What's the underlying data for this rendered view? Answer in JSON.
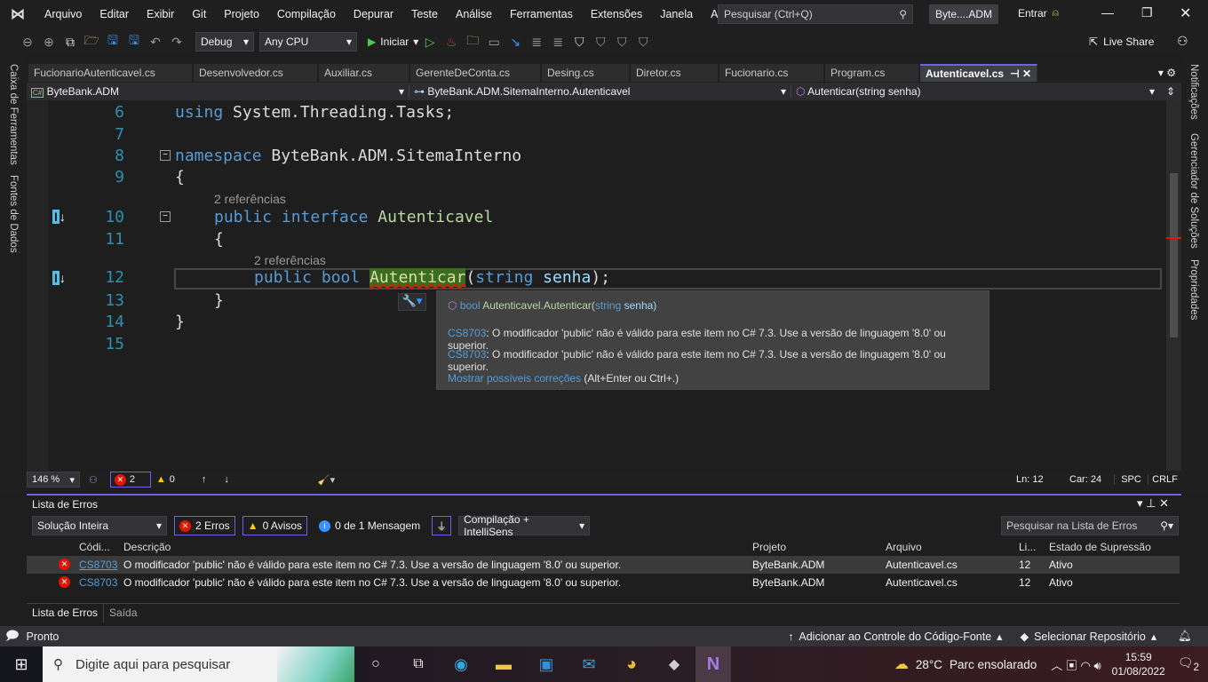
{
  "menu": [
    "Arquivo",
    "Editar",
    "Exibir",
    "Git",
    "Projeto",
    "Compilação",
    "Depurar",
    "Teste",
    "Análise",
    "Ferramentas",
    "Extensões",
    "Janela",
    "Ajuda"
  ],
  "search_placeholder": "Pesquisar (Ctrl+Q)",
  "solution_name": "Byte....ADM",
  "signin": "Entrar",
  "toolbar": {
    "config": "Debug",
    "platform": "Any CPU",
    "start": "Iniciar",
    "live_share": "Live Share"
  },
  "left_strip": [
    "Caixa de Ferramentas",
    "Fontes de Dados"
  ],
  "right_strip": [
    "Notificações",
    "Gerenciador de Soluções",
    "Propriedades"
  ],
  "tabs": [
    "FucionarioAutenticavel.cs",
    "Desenvolvedor.cs",
    "Auxiliar.cs",
    "GerenteDeConta.cs",
    "Desing.cs",
    "Diretor.cs",
    "Fucionario.cs",
    "Program.cs",
    "Autenticavel.cs"
  ],
  "nav": {
    "project": "ByteBank.ADM",
    "type": "ByteBank.ADM.SitemaInterno.Autenticavel",
    "member": "Autenticar(string senha)"
  },
  "code": {
    "lines": [
      "6",
      "7",
      "8",
      "9",
      "10",
      "11",
      "12",
      "13",
      "14",
      "15"
    ],
    "l6a": "using",
    "l6b": " System.Threading.Tasks;",
    "l8a": "namespace",
    "l8b": " ByteBank.ADM.SitemaInterno",
    "brace_open": "{",
    "brace_close": "}",
    "refs": "2 referências",
    "l10a": "public",
    "l10b": "interface",
    "l10c": "Autenticavel",
    "l12a": "public",
    "l12b": "bool",
    "l12c": "Autenticar",
    "l12d": "(",
    "l12e": "string",
    "l12f": "senha",
    "l12g": ");"
  },
  "tooltip": {
    "sig_a": "bool",
    "sig_b": "Autenticavel.Autenticar(",
    "sig_c": "string",
    "sig_d": "senha)",
    "err_code": "CS8703",
    "err_msg": ": O modificador 'public' não é válido para este item no C# 7.3. Use a versão de linguagem '8.0' ou superior.",
    "fix_link": "Mostrar possíveis correções",
    "fix_keys": " (Alt+Enter ou Ctrl+.)"
  },
  "editor_status": {
    "zoom": "146 %",
    "errors": "2",
    "warnings": "0",
    "ln": "Ln: 12",
    "car": "Car: 24",
    "spc": "SPC",
    "crlf": "CRLF"
  },
  "error_list": {
    "title": "Lista de Erros",
    "scope": "Solução Inteira",
    "errors_btn": "2 Erros",
    "warnings_btn": "0 Avisos",
    "messages": "0 de 1 Mensagem",
    "source": "Compilação + IntelliSens",
    "search_placeholder": "Pesquisar na Lista de Erros",
    "columns": [
      "Códi...",
      "Descrição",
      "Projeto",
      "Arquivo",
      "Li...",
      "Estado de Supressão"
    ],
    "rows": [
      {
        "code": "CS8703",
        "desc": "O modificador 'public' não é válido para este item no C# 7.3. Use a versão de linguagem '8.0' ou superior.",
        "project": "ByteBank.ADM",
        "file": "Autenticavel.cs",
        "line": "12",
        "state": "Ativo"
      },
      {
        "code": "CS8703",
        "desc": "O modificador 'public' não é válido para este item no C# 7.3. Use a versão de linguagem '8.0' ou superior.",
        "project": "ByteBank.ADM",
        "file": "Autenticavel.cs",
        "line": "12",
        "state": "Ativo"
      }
    ],
    "bottom_tabs": [
      "Lista de Erros",
      "Saída"
    ]
  },
  "status": {
    "ready": "Pronto",
    "source_control": "Adicionar ao Controle do Código-Fonte",
    "repo": "Selecionar Repositório"
  },
  "taskbar": {
    "search": "Digite aqui para pesquisar",
    "temp": "28°C",
    "weather": "Parc ensolarado",
    "time": "15:59",
    "date": "01/08/2022",
    "notif": "2"
  },
  "colors": {
    "accent": "#7160e8",
    "error": "#e51400",
    "keyword": "#569cd6",
    "type": "#b8d7a3"
  }
}
